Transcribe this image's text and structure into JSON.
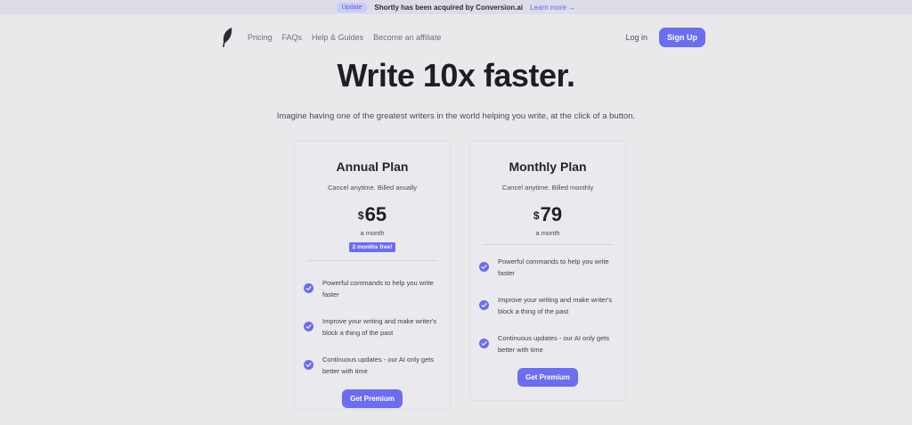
{
  "announcement": {
    "badge": "Update",
    "message": "Shortly has been acquired by Conversion.ai",
    "link": "Learn more →"
  },
  "nav": {
    "logo_icon": "feather-icon",
    "links": [
      "Pricing",
      "FAQs",
      "Help & Guides",
      "Become an affiliate"
    ],
    "login": "Log in",
    "signup": "Sign Up"
  },
  "hero": {
    "title": "Write 10x faster.",
    "subtitle": "Imagine having one of the greatest writers in the world helping you write, at the click of a button."
  },
  "plans": [
    {
      "name": "Annual Plan",
      "billing": "Cancel anytime. Billed anually",
      "currency": "$",
      "price": "65",
      "period": "a month",
      "promo": "2 months free!",
      "features": [
        "Powerful commands to help you write faster",
        "Improve your writing and make writer's block a thing of the past",
        "Continuous updates - our AI only gets better with time"
      ],
      "cta": "Get Premium"
    },
    {
      "name": "Monthly Plan",
      "billing": "Cancel anytime. Billed monthly",
      "currency": "$",
      "price": "79",
      "period": "a month",
      "features": [
        "Powerful commands to help you write faster",
        "Improve your writing and make writer's block a thing of the past",
        "Continuous updates - our AI only gets better with time"
      ],
      "cta": "Get Premium"
    }
  ],
  "colors": {
    "accent": "#6b6df2",
    "background": "#e9e9ec",
    "announcement_bg": "#dcdde9"
  }
}
